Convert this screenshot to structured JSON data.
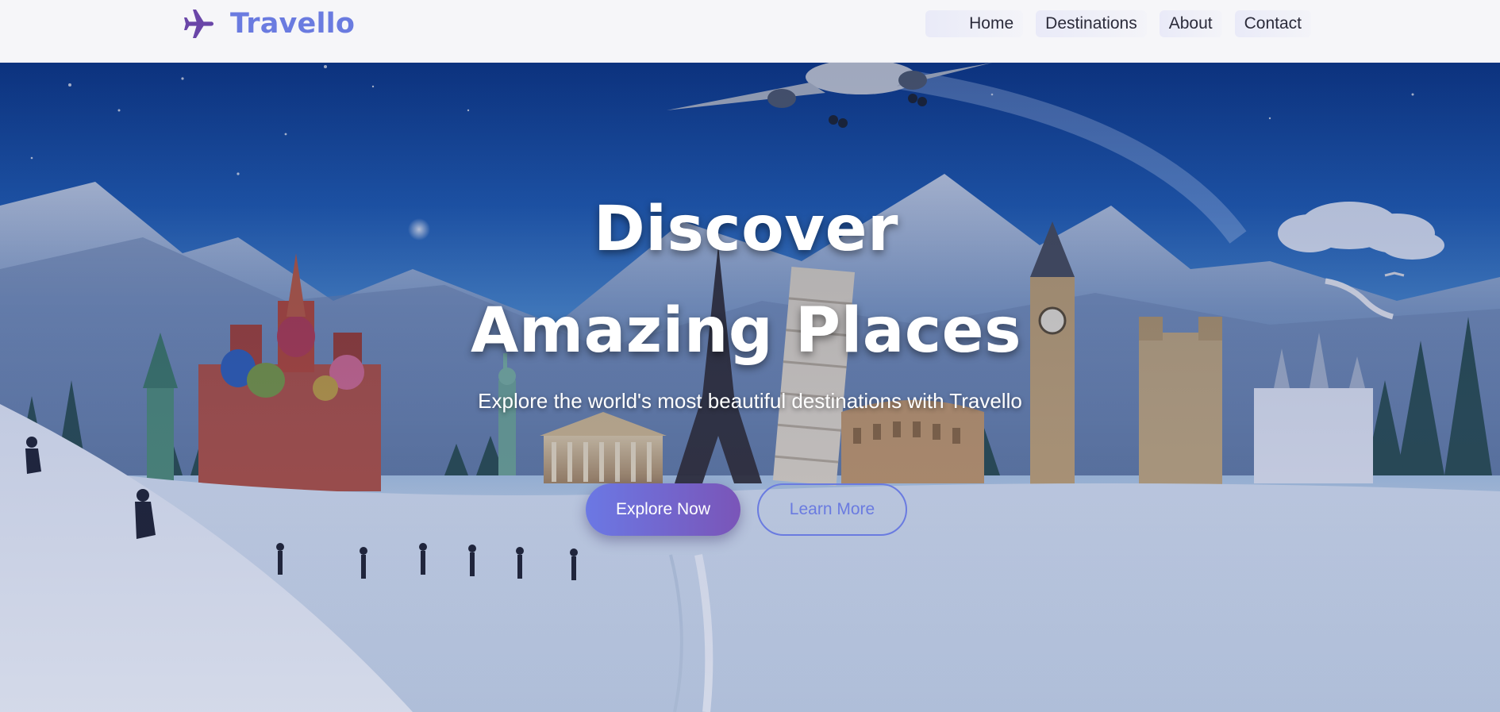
{
  "brand": {
    "name": "Travello",
    "icon": "airplane-icon",
    "color": "#6a7be0"
  },
  "nav": {
    "links": [
      "Home",
      "Destinations",
      "About",
      "Contact"
    ]
  },
  "hero": {
    "title_line1": "Discover",
    "title_line2": "Amazing Places",
    "subtitle": "Explore the world's most beautiful destinations with Travello",
    "primary_button": "Explore Now",
    "secondary_button": "Learn More"
  },
  "colors": {
    "accent": "#6a7be0",
    "button_gradient_start": "#6b78e4",
    "button_gradient_end": "#7a55b8",
    "navbar_bg": "#f6f6f9",
    "nav_text": "#2b2b3a"
  }
}
